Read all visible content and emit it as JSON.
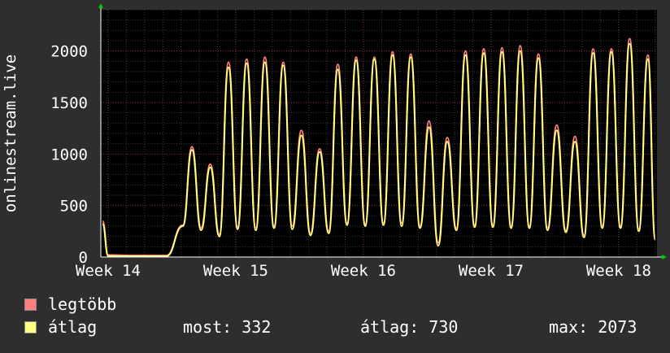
{
  "chart_data": {
    "type": "line",
    "ylabel": "onlinestream.live",
    "xlabel": "",
    "title": "",
    "ylim": [
      0,
      2400
    ],
    "yticks": [
      0,
      500,
      1000,
      1500,
      2000
    ],
    "xticks": [
      "Week 14",
      "Week 15",
      "Week 16",
      "Week 17",
      "Week 18"
    ],
    "xtick_positions_days": [
      0,
      7,
      14,
      21,
      28
    ],
    "x_range_days": [
      -0.4,
      30.1
    ],
    "grid": true,
    "colors": {
      "background": "#2e2e2e",
      "plot_background": "#000000",
      "grid_minor": "#3a3a3a",
      "grid_major": "#8a3a3a",
      "axis": "#ffffff",
      "arrow": "#00cc00",
      "max_series": "#ff7f7f",
      "avg_series": "#ffff80"
    },
    "daily_peaks": [
      {
        "day": -0.3,
        "max": 350,
        "avg": 320
      },
      {
        "day": 0.2,
        "max": 20,
        "avg": 10
      },
      {
        "day": 1.2,
        "max": 15,
        "avg": 8
      },
      {
        "day": 2.2,
        "max": 15,
        "avg": 8
      },
      {
        "day": 3.2,
        "max": 15,
        "avg": 8
      },
      {
        "day": 4.6,
        "max": 1070,
        "avg": 1040
      },
      {
        "day": 5.6,
        "max": 900,
        "avg": 870
      },
      {
        "day": 6.6,
        "max": 1890,
        "avg": 1840
      },
      {
        "day": 7.6,
        "max": 1920,
        "avg": 1880
      },
      {
        "day": 8.6,
        "max": 1940,
        "avg": 1890
      },
      {
        "day": 9.6,
        "max": 1890,
        "avg": 1860
      },
      {
        "day": 10.6,
        "max": 1230,
        "avg": 1180
      },
      {
        "day": 11.6,
        "max": 1050,
        "avg": 1020
      },
      {
        "day": 12.6,
        "max": 1870,
        "avg": 1820
      },
      {
        "day": 13.6,
        "max": 1940,
        "avg": 1910
      },
      {
        "day": 14.6,
        "max": 1940,
        "avg": 1920
      },
      {
        "day": 15.6,
        "max": 1990,
        "avg": 1960
      },
      {
        "day": 16.6,
        "max": 1970,
        "avg": 1940
      },
      {
        "day": 17.6,
        "max": 1320,
        "avg": 1260
      },
      {
        "day": 18.6,
        "max": 1160,
        "avg": 1120
      },
      {
        "day": 19.6,
        "max": 2000,
        "avg": 1960
      },
      {
        "day": 20.6,
        "max": 2020,
        "avg": 1980
      },
      {
        "day": 21.6,
        "max": 2030,
        "avg": 1990
      },
      {
        "day": 22.6,
        "max": 2050,
        "avg": 2000
      },
      {
        "day": 23.6,
        "max": 1970,
        "avg": 1930
      },
      {
        "day": 24.6,
        "max": 1280,
        "avg": 1230
      },
      {
        "day": 25.6,
        "max": 1170,
        "avg": 1120
      },
      {
        "day": 26.6,
        "max": 2020,
        "avg": 1980
      },
      {
        "day": 27.6,
        "max": 2020,
        "avg": 1990
      },
      {
        "day": 28.6,
        "max": 2120,
        "avg": 2070
      },
      {
        "day": 29.6,
        "max": 1960,
        "avg": 1920
      }
    ],
    "daily_troughs": [
      {
        "day": 0.0,
        "max": 20,
        "avg": 10
      },
      {
        "day": 4.1,
        "max": 310,
        "avg": 300
      },
      {
        "day": 5.1,
        "max": 280,
        "avg": 260
      },
      {
        "day": 6.1,
        "max": 220,
        "avg": 200
      },
      {
        "day": 7.1,
        "max": 290,
        "avg": 270
      },
      {
        "day": 8.1,
        "max": 280,
        "avg": 260
      },
      {
        "day": 9.1,
        "max": 300,
        "avg": 280
      },
      {
        "day": 10.1,
        "max": 300,
        "avg": 270
      },
      {
        "day": 11.1,
        "max": 230,
        "avg": 210
      },
      {
        "day": 12.1,
        "max": 250,
        "avg": 230
      },
      {
        "day": 13.1,
        "max": 330,
        "avg": 310
      },
      {
        "day": 14.1,
        "max": 320,
        "avg": 300
      },
      {
        "day": 15.1,
        "max": 330,
        "avg": 310
      },
      {
        "day": 16.1,
        "max": 330,
        "avg": 300
      },
      {
        "day": 17.1,
        "max": 300,
        "avg": 280
      },
      {
        "day": 18.1,
        "max": 140,
        "avg": 110
      },
      {
        "day": 19.1,
        "max": 280,
        "avg": 260
      },
      {
        "day": 20.1,
        "max": 310,
        "avg": 290
      },
      {
        "day": 21.1,
        "max": 310,
        "avg": 290
      },
      {
        "day": 22.1,
        "max": 300,
        "avg": 280
      },
      {
        "day": 23.1,
        "max": 300,
        "avg": 280
      },
      {
        "day": 24.1,
        "max": 280,
        "avg": 260
      },
      {
        "day": 25.1,
        "max": 260,
        "avg": 240
      },
      {
        "day": 26.1,
        "max": 210,
        "avg": 190
      },
      {
        "day": 27.1,
        "max": 300,
        "avg": 280
      },
      {
        "day": 28.1,
        "max": 300,
        "avg": 280
      },
      {
        "day": 29.1,
        "max": 270,
        "avg": 250
      },
      {
        "day": 30.0,
        "max": 200,
        "avg": 170
      }
    ],
    "series": [
      {
        "name": "legtöbb",
        "color": "#ff7f7f"
      },
      {
        "name": "átlag",
        "color": "#ffff80"
      }
    ]
  },
  "legend": {
    "max_label": "legtöbb",
    "avg_label": "átlag",
    "now_stat": "most: 332",
    "avg_stat": "átlag: 730",
    "max_stat": "max: 2073"
  }
}
